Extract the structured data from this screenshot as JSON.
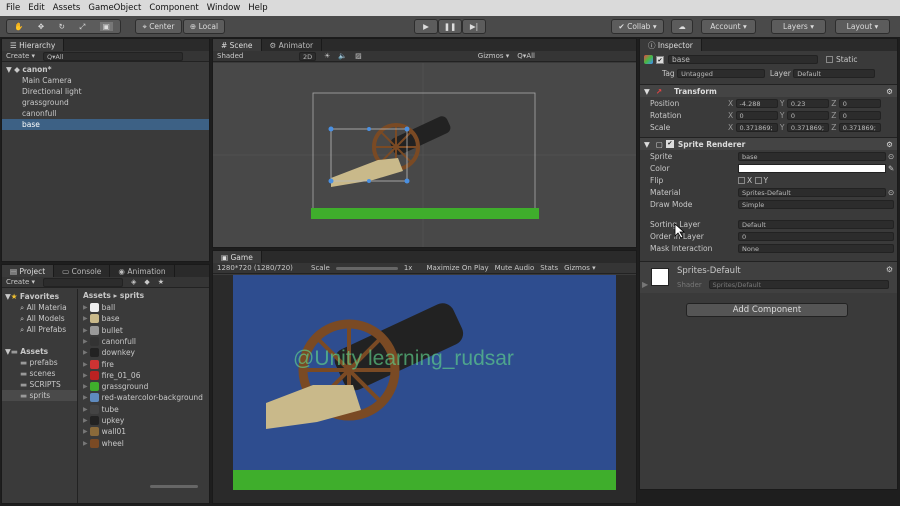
{
  "menu": [
    "File",
    "Edit",
    "Assets",
    "GameObject",
    "Component",
    "Window",
    "Help"
  ],
  "toolbar": {
    "center": "Center",
    "local": "Local",
    "collab": "Collab ▾",
    "account": "Account ▾",
    "layers": "Layers ▾",
    "layout": "Layout ▾"
  },
  "hierarchy": {
    "tab": "Hierarchy",
    "create": "Create ▾",
    "search": "Q▾All",
    "scene": "canon*",
    "items": [
      "Main Camera",
      "Directional light",
      "grassground",
      "canonfull",
      "base"
    ]
  },
  "scene": {
    "tab": "Scene",
    "tab2": "Animator",
    "shading": "Shaded",
    "mode2d": "2D",
    "gizmos": "Gizmos ▾",
    "search": "Q▾All"
  },
  "game": {
    "tab": "Game",
    "resolution": "1280*720 (1280/720)",
    "scale_label": "Scale",
    "scale_value": "1x",
    "maximize": "Maximize On Play",
    "mute": "Mute Audio",
    "stats": "Stats",
    "gizmos": "Gizmos ▾",
    "watermark": "@Unity learning_rudsar"
  },
  "project": {
    "tab": "Project",
    "tab2": "Console",
    "tab3": "Animation",
    "create": "Create ▾",
    "favorites_label": "Favorites",
    "favorites": [
      "All Materia",
      "All Models",
      "All Prefabs"
    ],
    "assets_label": "Assets",
    "folders": [
      "prefabs",
      "scenes",
      "SCRIPTS",
      "sprits"
    ],
    "breadcrumb_root": "Assets",
    "breadcrumb_leaf": "sprits",
    "files": [
      "ball",
      "base",
      "bullet",
      "canonfull",
      "downkey",
      "fire",
      "fire_01_06",
      "grassground",
      "red-watercolor-background",
      "tube",
      "upkey",
      "wall01",
      "wheel"
    ]
  },
  "inspector": {
    "tab": "Inspector",
    "name": "base",
    "static": "Static",
    "tag_label": "Tag",
    "tag": "Untagged",
    "layer_label": "Layer",
    "layer": "Default",
    "transform": "Transform",
    "position": {
      "label": "Position",
      "x": "-4.288",
      "y": "0.23",
      "z": "0"
    },
    "rotation": {
      "label": "Rotation",
      "x": "0",
      "y": "0",
      "z": "0"
    },
    "scale": {
      "label": "Scale",
      "x": "0.371869;",
      "y": "0.371869;",
      "z": "0.371869;"
    },
    "sprite_renderer": "Sprite Renderer",
    "sprite_label": "Sprite",
    "sprite": "base",
    "color_label": "Color",
    "flip_label": "Flip",
    "flip_x": "X",
    "flip_y": "Y",
    "material_label": "Material",
    "material": "Sprites-Default",
    "draw_mode_label": "Draw Mode",
    "draw_mode": "Simple",
    "sorting_layer_label": "Sorting Layer",
    "sorting_layer": "Default",
    "order_label": "Order in Layer",
    "order": "0",
    "mask_label": "Mask Interaction",
    "mask": "None",
    "mat_name": "Sprites-Default",
    "shader_label": "Shader",
    "shader": "Sprites/Default",
    "add_component": "Add Component"
  },
  "colors": {
    "accent": "#3d6185",
    "game_bg": "#2e4d8f",
    "grass": "#3fae2c"
  }
}
